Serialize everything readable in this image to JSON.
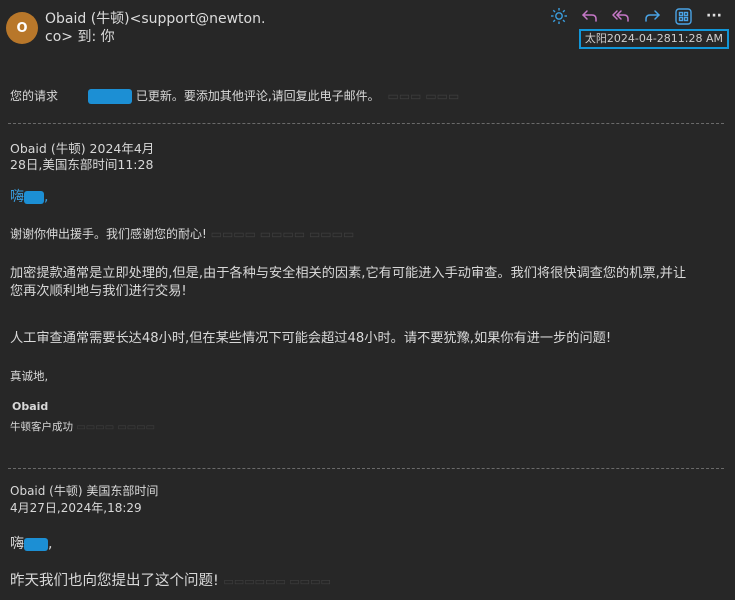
{
  "header": {
    "avatar_initial": "O",
    "sender_line1": "Obaid (牛顿)<support@newton.",
    "sender_line2": "co> 到: 你",
    "datetime": "太阳2024-04-2811:28 AM"
  },
  "toolbar": {
    "icons": [
      "brightness-icon",
      "reply-icon",
      "reply-all-icon",
      "forward-icon",
      "apps-icon",
      "more-icon"
    ],
    "more_label": "···"
  },
  "colors": {
    "background": "#272727",
    "redaction": "#1c8fd4",
    "highlight_border": "#1296d8",
    "avatar": "#b8772a"
  },
  "notice": {
    "prefix": "您的请求",
    "suffix": "已更新。要添加其他评论,请回复此电子邮件。"
  },
  "message1": {
    "author_date_line1": "Obaid (牛顿) 2024年4月",
    "author_date_line2": "28日,美国东部时间11:28",
    "greeting": "嗨",
    "greeting_punct": ",",
    "thanks": "谢谢你伸出援手。我们感谢您的耐心!",
    "para1_line1": "加密提款通常是立即处理的,但是,由于各种与安全相关的因素,它有可能进入手动审查。我们将很快调查您的机票,并让",
    "para1_line2": "您再次顺利地与我们进行交易!",
    "para2": "人工审查通常需要长达48小时,但在某些情况下可能会超过48小时。请不要犹豫,如果你有进一步的问题!",
    "signoff": "真诚地,",
    "sig_name": "Obaid",
    "sig_title": "牛顿客户成功"
  },
  "message2": {
    "author_line": "Obaid (牛顿) 美国东部时间",
    "date_line": "4月27日,2024年,18:29",
    "greeting": "嗨",
    "greeting_punct": ",",
    "body": "昨天我们也向您提出了这个问题!"
  }
}
